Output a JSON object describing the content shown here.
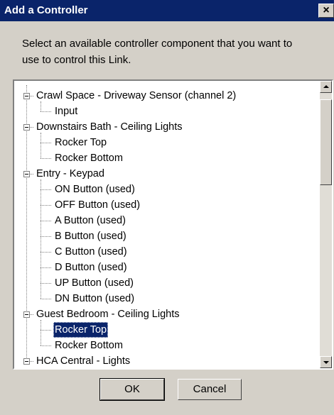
{
  "window": {
    "title": "Add a Controller",
    "close_label": "×"
  },
  "prompt": "Select an available controller component that you want to use to control this Link.",
  "tree": {
    "nodes": [
      {
        "label": "Crawl Space - Driveway Sensor (channel 2)",
        "level": 0,
        "expanded": true
      },
      {
        "label": "Input",
        "level": 1
      },
      {
        "label": "Downstairs Bath - Ceiling Lights",
        "level": 0,
        "expanded": true
      },
      {
        "label": "Rocker Top",
        "level": 1
      },
      {
        "label": "Rocker Bottom",
        "level": 1
      },
      {
        "label": "Entry - Keypad",
        "level": 0,
        "expanded": true
      },
      {
        "label": "ON Button (used)",
        "level": 1
      },
      {
        "label": "OFF Button (used)",
        "level": 1
      },
      {
        "label": "A Button (used)",
        "level": 1
      },
      {
        "label": "B Button (used)",
        "level": 1
      },
      {
        "label": "C Button (used)",
        "level": 1
      },
      {
        "label": "D Button (used)",
        "level": 1
      },
      {
        "label": "UP Button (used)",
        "level": 1
      },
      {
        "label": "DN Button (used)",
        "level": 1
      },
      {
        "label": "Guest Bedroom - Ceiling Lights",
        "level": 0,
        "expanded": true
      },
      {
        "label": "Rocker Top",
        "level": 1,
        "selected": true
      },
      {
        "label": "Rocker Bottom",
        "level": 1
      },
      {
        "label": "HCA Central - Lights",
        "level": 0,
        "expanded": true
      }
    ]
  },
  "buttons": {
    "ok": "OK",
    "cancel": "Cancel"
  }
}
